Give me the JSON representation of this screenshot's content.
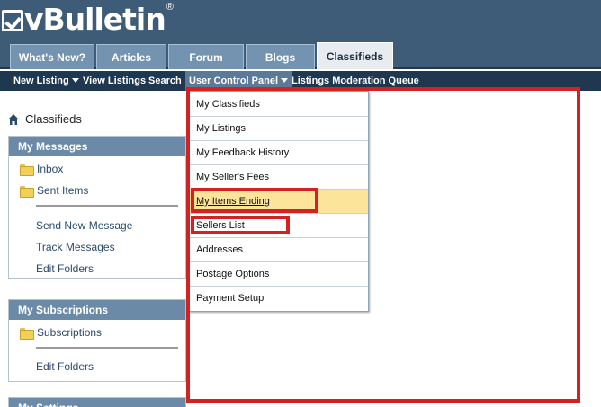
{
  "brand": {
    "logo_text": "vBulletin",
    "registered": "®"
  },
  "tabs": [
    {
      "label": "What's New?"
    },
    {
      "label": "Articles"
    },
    {
      "label": "Forum"
    },
    {
      "label": "Blogs"
    },
    {
      "label": "Classifieds",
      "active": true
    }
  ],
  "subnav": {
    "new_listing": "New Listing",
    "view_listings": "View Listings",
    "search": "Search",
    "user_cp": "User Control Panel",
    "moderation": "Listings Moderation Queue"
  },
  "breadcrumb": {
    "label": "Classifieds"
  },
  "sidebar": {
    "messages": {
      "title": "My Messages",
      "inbox": "Inbox",
      "sent": "Sent Items",
      "send_new": "Send New Message",
      "track": "Track Messages",
      "edit_folders": "Edit Folders"
    },
    "subscriptions": {
      "title": "My Subscriptions",
      "subscriptions": "Subscriptions",
      "edit_folders": "Edit Folders"
    },
    "settings": {
      "title": "My Settings"
    }
  },
  "dropdown": {
    "items": [
      "My Classifieds",
      "My Listings",
      "My Feedback History",
      "My Seller's Fees",
      "My Items Ending",
      "Sellers List",
      "Addresses",
      "Postage Options",
      "Payment Setup"
    ]
  },
  "colors": {
    "header": "#3e5c78",
    "subnav": "#1f3850",
    "annotation": "#d42222",
    "hover": "#fce59b"
  }
}
